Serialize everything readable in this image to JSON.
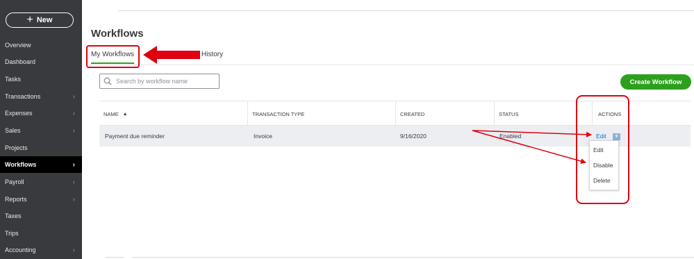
{
  "sidebar": {
    "new_label": "New",
    "items": [
      {
        "label": "Overview",
        "chevron": ""
      },
      {
        "label": "Dashboard",
        "chevron": ""
      },
      {
        "label": "Tasks",
        "chevron": ""
      },
      {
        "label": "Transactions",
        "chevron": "›"
      },
      {
        "label": "Expenses",
        "chevron": "›"
      },
      {
        "label": "Sales",
        "chevron": "›"
      },
      {
        "label": "Projects",
        "chevron": ""
      },
      {
        "label": "Workflows",
        "chevron": "›"
      },
      {
        "label": "Payroll",
        "chevron": "›"
      },
      {
        "label": "Reports",
        "chevron": "›"
      },
      {
        "label": "Taxes",
        "chevron": ""
      },
      {
        "label": "Trips",
        "chevron": ""
      },
      {
        "label": "Accounting",
        "chevron": "›"
      }
    ],
    "active_item": "Workflows"
  },
  "page": {
    "title": "Workflows",
    "tabs": [
      {
        "label": "My Workflows",
        "active": true
      },
      {
        "label": "History",
        "active": false
      }
    ]
  },
  "search": {
    "placeholder": "Search by workflow name",
    "value": ""
  },
  "create_button_label": "Create Workflow",
  "table": {
    "headers": {
      "name": "NAME",
      "transaction_type": "TRANSACTION TYPE",
      "created": "CREATED",
      "status": "STATUS",
      "actions": "ACTIONS"
    },
    "sort_indicator": "▲",
    "rows": [
      {
        "name": "Payment due reminder",
        "transaction_type": "Invoice",
        "created": "9/16/2020",
        "status": "Enabled",
        "action_label": "Edit"
      }
    ]
  },
  "actions_menu": {
    "items": [
      "Edit",
      "Disable",
      "Delete"
    ]
  },
  "colors": {
    "sidebar_bg": "#393a3d",
    "accent_green": "#2ca01c",
    "link_blue": "#0077c5",
    "annotation_red": "#e0000f"
  },
  "icons": {
    "new": "plus-icon",
    "search": "search-icon",
    "sort": "sort-ascending-icon",
    "dropdown": "caret-down-icon",
    "nav": "chevron-right-icon"
  }
}
